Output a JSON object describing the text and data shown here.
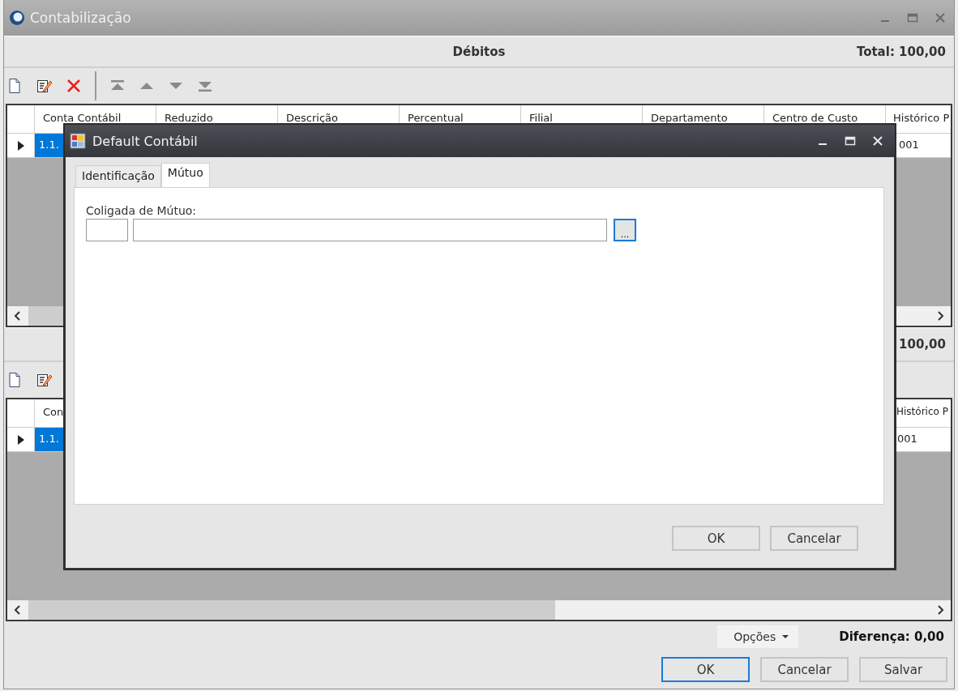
{
  "window": {
    "title": "Contabilização"
  },
  "sections": [
    {
      "kind": "debits",
      "title": "Débitos",
      "total": "Total: 100,00",
      "tools": [
        {
          "kind": "new"
        },
        {
          "kind": "edit"
        },
        {
          "kind": "delete"
        },
        {
          "kind": "separator"
        },
        {
          "kind": "first"
        },
        {
          "kind": "up"
        },
        {
          "kind": "down"
        },
        {
          "kind": "last"
        }
      ],
      "grid": {
        "columns": [
          "Conta Contábil",
          "Reduzido",
          "Descrição",
          "Percentual",
          "Filial",
          "Departamento",
          "Centro de Custo",
          "Histórico P"
        ],
        "rows": [
          {
            "selected": true,
            "cells": [
              "1.1.",
              "",
              "",
              "",
              "",
              "",
              "",
              "001"
            ]
          }
        ]
      }
    },
    {
      "kind": "credits",
      "total": "100,00",
      "tools": [
        {
          "kind": "new"
        },
        {
          "kind": "edit"
        }
      ],
      "grid": {
        "columns": [
          "Con",
          "Histórico P"
        ],
        "rows": [
          {
            "selected": true,
            "cells": [
              "1.1.",
              "001"
            ]
          }
        ]
      }
    }
  ],
  "footer": {
    "options": "Opções",
    "difference": "Diferença: 0,00",
    "buttons": [
      {
        "label": "OK",
        "focused": true
      },
      {
        "label": "Cancelar",
        "focused": false
      },
      {
        "label": "Salvar",
        "focused": false
      }
    ]
  },
  "dialog": {
    "title": "Default Contábil",
    "tabs": [
      {
        "label": "Identificação",
        "selected": false
      },
      {
        "label": "Mútuo",
        "selected": true
      }
    ],
    "field_label": "Coligada de Mútuo:",
    "browse": "...",
    "buttons": [
      {
        "label": "OK",
        "focused": false
      },
      {
        "label": "Cancelar",
        "focused": false
      }
    ]
  }
}
